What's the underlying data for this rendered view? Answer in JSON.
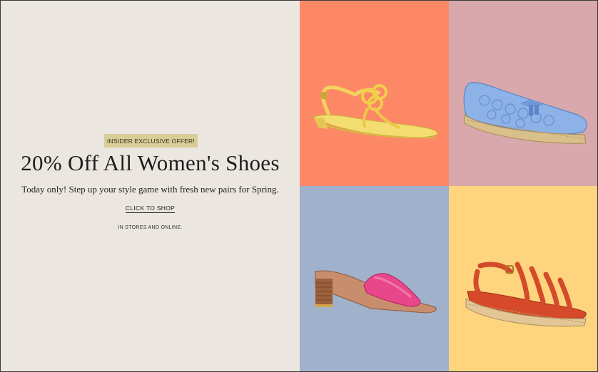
{
  "promo": {
    "badge": "INSIDER EXCLUSIVE OFFER!",
    "headline": "20% Off All Women's Shoes",
    "subtext": "Today only! Step up your style game with fresh new pairs for Spring.",
    "cta": "CLICK TO SHOP",
    "note": "IN STORES AND ONLINE."
  },
  "tiles": [
    {
      "product": "yellow-thong-sandal",
      "background": "#fd8866"
    },
    {
      "product": "blue-espadrille-slip-on",
      "background": "#d8a8ac"
    },
    {
      "product": "pink-block-heel-slide",
      "background": "#a0b1cb"
    },
    {
      "product": "red-strappy-espadrille-sandal",
      "background": "#fed57e"
    }
  ]
}
